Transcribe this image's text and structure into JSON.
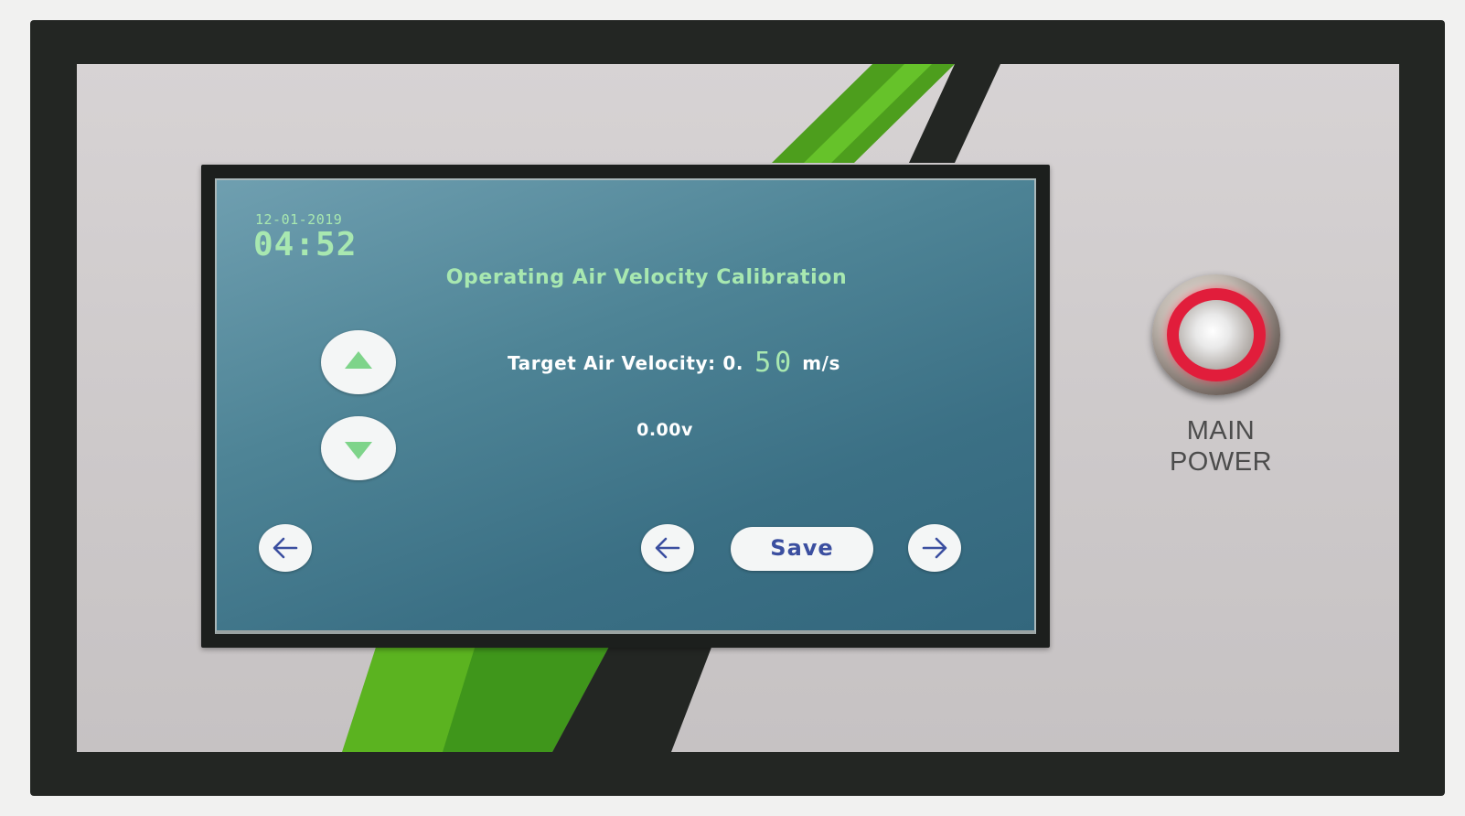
{
  "screen": {
    "date": "12-01-2019",
    "time": "04:52",
    "title": "Operating Air Velocity Calibration",
    "target_label": "Target Air Velocity: 0.",
    "target_value_digits": "50",
    "target_unit": "m/s",
    "voltage": "0.00v",
    "save_label": "Save",
    "icons": {
      "up": "triangle-up-icon",
      "down": "triangle-down-icon",
      "back": "arrow-left-icon",
      "forward": "arrow-right-icon"
    }
  },
  "device": {
    "power_label_line1": "MAIN",
    "power_label_line2": "POWER"
  },
  "colors": {
    "screen_text_green": "#a8e8b0",
    "arrow_blue": "#3b4fa0",
    "power_ring_red": "#e11d3b",
    "decor_green": "#5bb320"
  }
}
